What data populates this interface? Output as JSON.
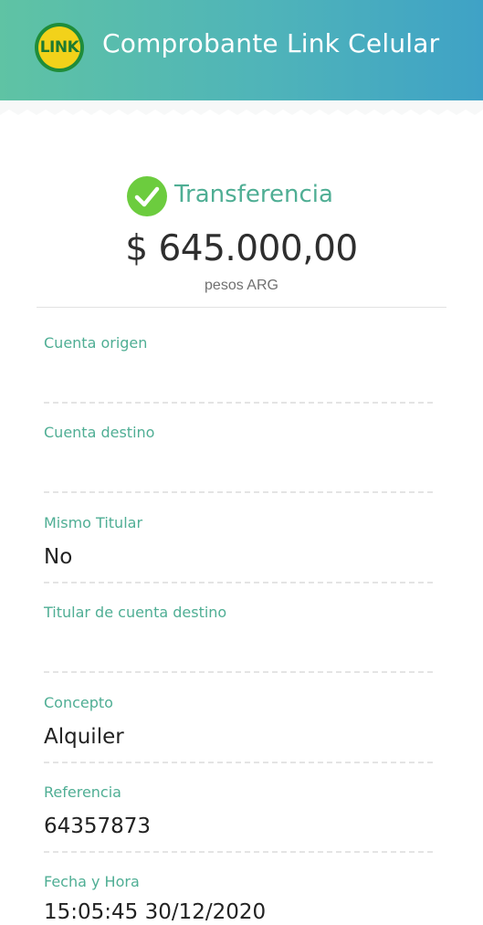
{
  "header": {
    "logo_text": "LINK",
    "title": "Comprobante Link Celular"
  },
  "receipt": {
    "type": "Transferencia",
    "amount": "$ 645.000,00",
    "currency": "pesos ARG"
  },
  "fields": [
    {
      "label": "Cuenta origen",
      "value": ""
    },
    {
      "label": "Cuenta destino",
      "value": ""
    },
    {
      "label": "Mismo Titular",
      "value": "No"
    },
    {
      "label": "Titular de cuenta destino",
      "value": ""
    },
    {
      "label": "Concepto",
      "value": "Alquiler"
    },
    {
      "label": "Referencia",
      "value": "64357873"
    },
    {
      "label": "Fecha y Hora",
      "value": "15:05:45 30/12/2020"
    }
  ],
  "colors": {
    "accent": "#4fae94",
    "check": "#6ccc3e",
    "header_start": "#5fc3a4",
    "header_end": "#3fa2c6"
  }
}
